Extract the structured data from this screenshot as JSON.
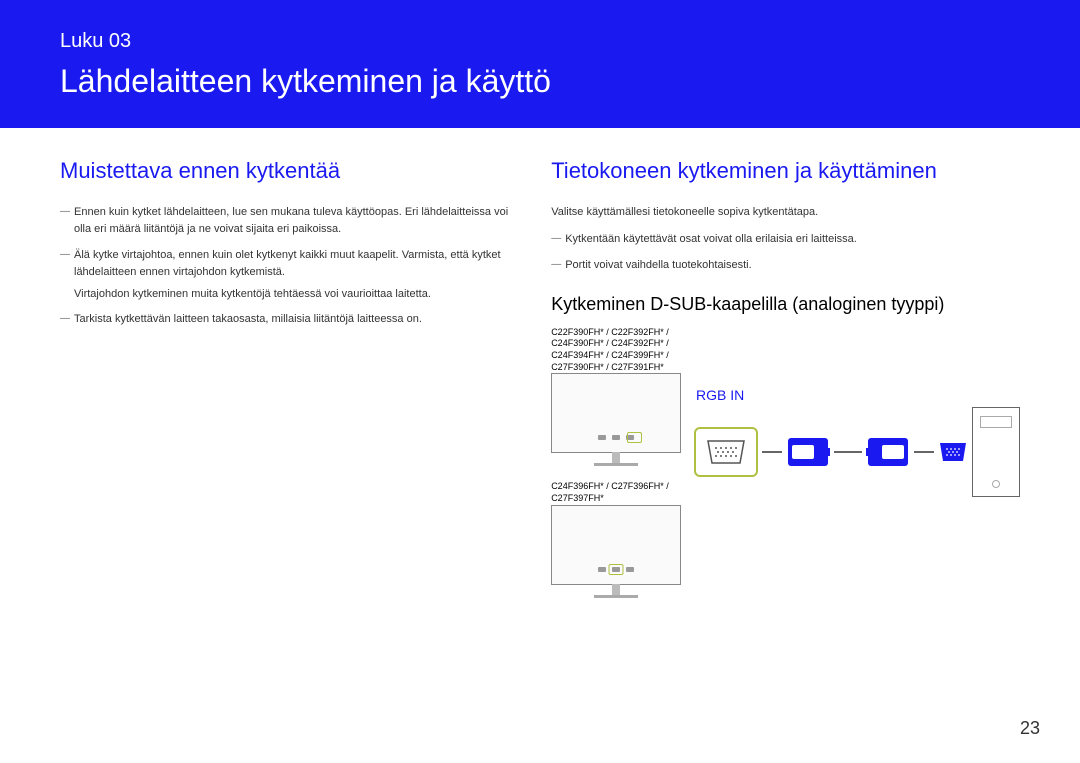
{
  "header": {
    "chapter_label": "Luku 03",
    "chapter_title": "Lähdelaitteen kytkeminen ja käyttö"
  },
  "left": {
    "heading": "Muistettava ennen kytkentää",
    "notes": [
      "Ennen kuin kytket lähdelaitteen, lue sen mukana tuleva käyttöopas. Eri lähdelaitteissa voi olla eri määrä liitäntöjä ja ne voivat sijaita eri paikoissa.",
      "Älä kytke virtajohtoa, ennen kuin olet kytkenyt kaikki muut kaapelit. Varmista, että kytket lähdelaitteen ennen virtajohdon kytkemistä.",
      "Tarkista kytkettävän laitteen takaosasta, millaisia liitäntöjä laitteessa on."
    ],
    "sub_note": "Virtajohdon kytkeminen muita kytkentöjä tehtäessä voi vaurioittaa laitetta."
  },
  "right": {
    "heading": "Tietokoneen kytkeminen ja käyttäminen",
    "intro": "Valitse käyttämällesi tietokoneelle sopiva kytkentätapa.",
    "notes": [
      "Kytkentään käytettävät osat voivat olla erilaisia eri laitteissa.",
      "Portit voivat vaihdella tuotekohtaisesti."
    ],
    "sub_heading": "Kytkeminen D-SUB-kaapelilla (analoginen tyyppi)",
    "model_group_1": "C22F390FH* / C22F392FH* / C24F390FH* / C24F392FH* / C24F394FH* / C24F399FH* / C27F390FH* / C27F391FH*",
    "model_group_2": "C24F396FH* / C27F396FH* / C27F397FH*",
    "rgb_label": "RGB IN"
  },
  "page_number": "23"
}
